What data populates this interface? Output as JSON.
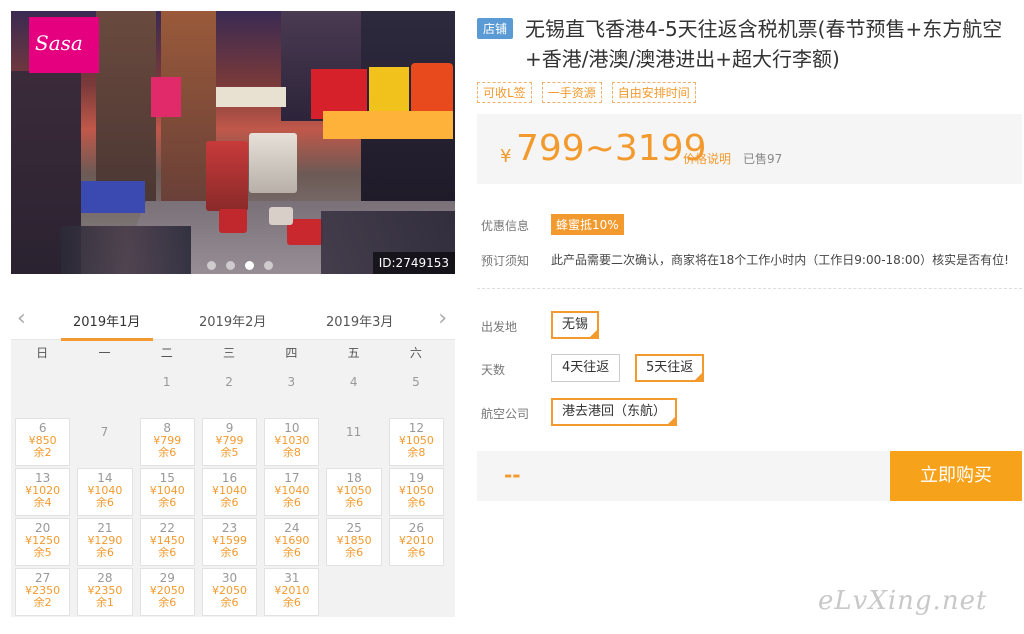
{
  "photo": {
    "sign_text": "Sasa",
    "id_label": "ID:2749153",
    "carousel": {
      "count": 4,
      "active_index": 2
    }
  },
  "calendar": {
    "months": [
      "2019年1月",
      "2019年2月",
      "2019年3月"
    ],
    "active_month": "2019年1月",
    "prev_icon": "chevron-left-icon",
    "next_icon": "chevron-right-icon",
    "weekdays": [
      "日",
      "一",
      "二",
      "三",
      "四",
      "五",
      "六"
    ],
    "cells": [
      {
        "day": "",
        "price": "",
        "remain": ""
      },
      {
        "day": "",
        "price": "",
        "remain": ""
      },
      {
        "day": "1",
        "price": "",
        "remain": ""
      },
      {
        "day": "2",
        "price": "",
        "remain": ""
      },
      {
        "day": "3",
        "price": "",
        "remain": ""
      },
      {
        "day": "4",
        "price": "",
        "remain": ""
      },
      {
        "day": "5",
        "price": "",
        "remain": ""
      },
      {
        "day": "6",
        "price": "¥850",
        "remain": "余2"
      },
      {
        "day": "7",
        "price": "",
        "remain": ""
      },
      {
        "day": "8",
        "price": "¥799",
        "remain": "余6"
      },
      {
        "day": "9",
        "price": "¥799",
        "remain": "余5"
      },
      {
        "day": "10",
        "price": "¥1030",
        "remain": "余8"
      },
      {
        "day": "11",
        "price": "",
        "remain": ""
      },
      {
        "day": "12",
        "price": "¥1050",
        "remain": "余8"
      },
      {
        "day": "13",
        "price": "¥1020",
        "remain": "余4"
      },
      {
        "day": "14",
        "price": "¥1040",
        "remain": "余6"
      },
      {
        "day": "15",
        "price": "¥1040",
        "remain": "余6"
      },
      {
        "day": "16",
        "price": "¥1040",
        "remain": "余6"
      },
      {
        "day": "17",
        "price": "¥1040",
        "remain": "余6"
      },
      {
        "day": "18",
        "price": "¥1050",
        "remain": "余6"
      },
      {
        "day": "19",
        "price": "¥1050",
        "remain": "余6"
      },
      {
        "day": "20",
        "price": "¥1250",
        "remain": "余5"
      },
      {
        "day": "21",
        "price": "¥1290",
        "remain": "余6"
      },
      {
        "day": "22",
        "price": "¥1450",
        "remain": "余6"
      },
      {
        "day": "23",
        "price": "¥1599",
        "remain": "余6"
      },
      {
        "day": "24",
        "price": "¥1690",
        "remain": "余6"
      },
      {
        "day": "25",
        "price": "¥1850",
        "remain": "余6"
      },
      {
        "day": "26",
        "price": "¥2010",
        "remain": "余6"
      },
      {
        "day": "27",
        "price": "¥2350",
        "remain": "余2"
      },
      {
        "day": "28",
        "price": "¥2350",
        "remain": "余1"
      },
      {
        "day": "29",
        "price": "¥2050",
        "remain": "余6"
      },
      {
        "day": "30",
        "price": "¥2050",
        "remain": "余6"
      },
      {
        "day": "31",
        "price": "¥2010",
        "remain": "余6"
      },
      {
        "day": "",
        "price": "",
        "remain": ""
      },
      {
        "day": "",
        "price": "",
        "remain": ""
      }
    ]
  },
  "product": {
    "shop_tag": "店铺",
    "title": "无锡直飞香港4-5天往返含税机票(春节预售+东方航空+香港/港澳/澳港进出+超大行李额)",
    "feature_tags": [
      "可收L签",
      "一手资源",
      "自由安排时间"
    ],
    "price": {
      "currency": "¥",
      "range": "799~3199",
      "note_link": "价格说明",
      "sold": "已售97"
    },
    "promo": {
      "label": "优惠信息",
      "badge": "蜂蜜抵10%"
    },
    "booking": {
      "label": "预订须知",
      "text": "此产品需要二次确认，商家将在18个工作小时内（工作日9:00-18:00）核实是否有位!"
    },
    "options": {
      "departure": {
        "label": "出发地",
        "items": [
          "无锡"
        ],
        "selected": 0
      },
      "days": {
        "label": "天数",
        "items": [
          "4天往返",
          "5天往返"
        ],
        "selected": 1
      },
      "airline": {
        "label": "航空公司",
        "items": [
          "港去港回（东航）"
        ],
        "selected": 0
      }
    },
    "total": "--",
    "buy_button": "立即购买"
  },
  "watermark": "eLvXing.net",
  "colors": {
    "accent": "#f39a2e",
    "buy": "#f7a21b",
    "shop_tag": "#5b9bd5"
  }
}
